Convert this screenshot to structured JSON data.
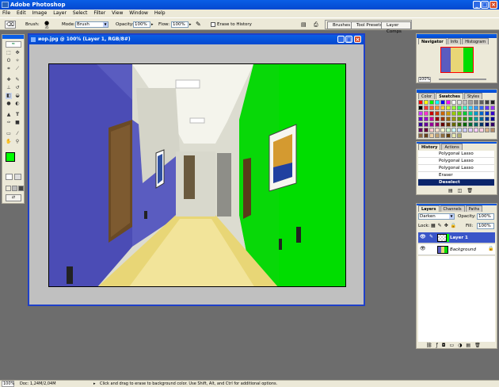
{
  "app": {
    "title": "Adobe Photoshop"
  },
  "menu": [
    "File",
    "Edit",
    "Image",
    "Layer",
    "Select",
    "Filter",
    "View",
    "Window",
    "Help"
  ],
  "options": {
    "brush_label": "Brush:",
    "brush_size": "35",
    "mode_label": "Mode:",
    "mode_value": "Brush",
    "opacity_label": "Opacity:",
    "opacity_value": "100%",
    "flow_label": "Flow:",
    "flow_value": "100%",
    "erase_history_label": "Erase to History",
    "well_tabs": [
      "Brushes",
      "Tool Presets",
      "Layer Comps"
    ]
  },
  "document": {
    "title": "иор.jpg @ 100% (Layer 1, RGB/8#)"
  },
  "navigator": {
    "tabs": [
      "Navigator",
      "Info",
      "Histogram"
    ],
    "zoom": "100%"
  },
  "swatches": {
    "tabs": [
      "Color",
      "Swatches",
      "Styles"
    ],
    "colors": [
      "#ff0000",
      "#ffff00",
      "#00ff00",
      "#00ffff",
      "#0000ff",
      "#ff00ff",
      "#ffffff",
      "#e0e0e0",
      "#c0c0c0",
      "#a0a0a0",
      "#808080",
      "#606060",
      "#404040",
      "#202020",
      "#000000",
      "#ff3333",
      "#ff6633",
      "#ff9933",
      "#ffcc33",
      "#ccff33",
      "#99ff33",
      "#33ff66",
      "#33ffcc",
      "#33ccff",
      "#3399ff",
      "#3366ff",
      "#6633ff",
      "#9933ff",
      "#cc33ff",
      "#ff33cc",
      "#cc0000",
      "#cc3300",
      "#cc6600",
      "#cc9900",
      "#99cc00",
      "#66cc00",
      "#00cc33",
      "#00cc99",
      "#0099cc",
      "#0066cc",
      "#0033cc",
      "#3300cc",
      "#6600cc",
      "#9900cc",
      "#cc0099",
      "#990000",
      "#993300",
      "#996600",
      "#999900",
      "#669900",
      "#339900",
      "#009933",
      "#009999",
      "#006699",
      "#003399",
      "#000099",
      "#330099",
      "#660099",
      "#990099",
      "#990066",
      "#660000",
      "#663300",
      "#666600",
      "#336600",
      "#006600",
      "#006633",
      "#006666",
      "#003366",
      "#000066",
      "#330066",
      "#660066",
      "#660033",
      "#ffcccc",
      "#ffe0cc",
      "#ffffcc",
      "#ccffcc",
      "#ccffff",
      "#cce0ff",
      "#ccccff",
      "#e0ccff",
      "#ffccff",
      "#ffcce0",
      "#d9b38c",
      "#b38c66",
      "#8c6640",
      "#66401a",
      "#f0d0a0",
      "#c0a070",
      "#907040",
      "#604010",
      "#e8e8b0",
      "#b0b070"
    ]
  },
  "history": {
    "tabs": [
      "History",
      "Actions"
    ],
    "items": [
      "Polygonal Lasso",
      "Polygonal Lasso",
      "Polygonal Lasso",
      "Eraser",
      "Deselect"
    ],
    "selected_index": 4
  },
  "layers": {
    "tabs": [
      "Layers",
      "Channels",
      "Paths"
    ],
    "blend_mode": "Darken",
    "opacity_label": "Opacity:",
    "opacity_value": "100%",
    "lock_label": "Lock:",
    "fill_label": "Fill:",
    "fill_value": "100%",
    "items": [
      {
        "name": "Layer 1"
      },
      {
        "name": "Background"
      }
    ]
  },
  "status": {
    "zoom": "100%",
    "doc": "Doc: 1,24M/2,04M",
    "hint": "Click and drag to erase to background color. Use Shift, Alt, and Ctrl for additional options."
  },
  "colors": {
    "foreground": "#00ff00",
    "background": "#000000",
    "titlebar": "#0a5ee6",
    "panel_bg": "#ece9d8",
    "workspace": "#6d6d6d"
  }
}
